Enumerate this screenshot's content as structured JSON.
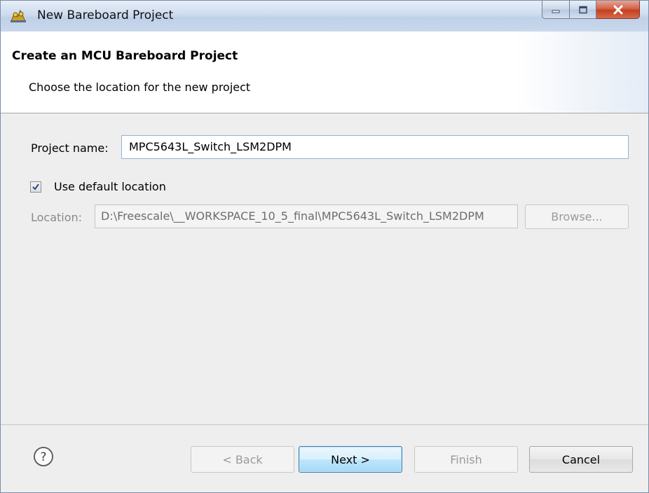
{
  "window": {
    "title": "New Bareboard Project",
    "icon": "eclipse-project-icon"
  },
  "header": {
    "title": "Create an MCU Bareboard Project",
    "subtitle": "Choose the location for the new project"
  },
  "form": {
    "project_name_label": "Project name:",
    "project_name_value": "MPC5643L_Switch_LSM2DPM",
    "use_default_label": "Use default location",
    "use_default_checked": true,
    "location_label": "Location:",
    "location_value": "D:\\Freescale\\__WORKSPACE_10_5_final\\MPC5643L_Switch_LSM2DPM",
    "browse_label": "Browse..."
  },
  "footer": {
    "help_icon": "help-icon",
    "back_label": "< Back",
    "next_label": "Next >",
    "finish_label": "Finish",
    "cancel_label": "Cancel"
  },
  "colors": {
    "titlebar": "#c9d8ec",
    "close_button": "#c2401f",
    "focus_border": "#3d7bad"
  }
}
